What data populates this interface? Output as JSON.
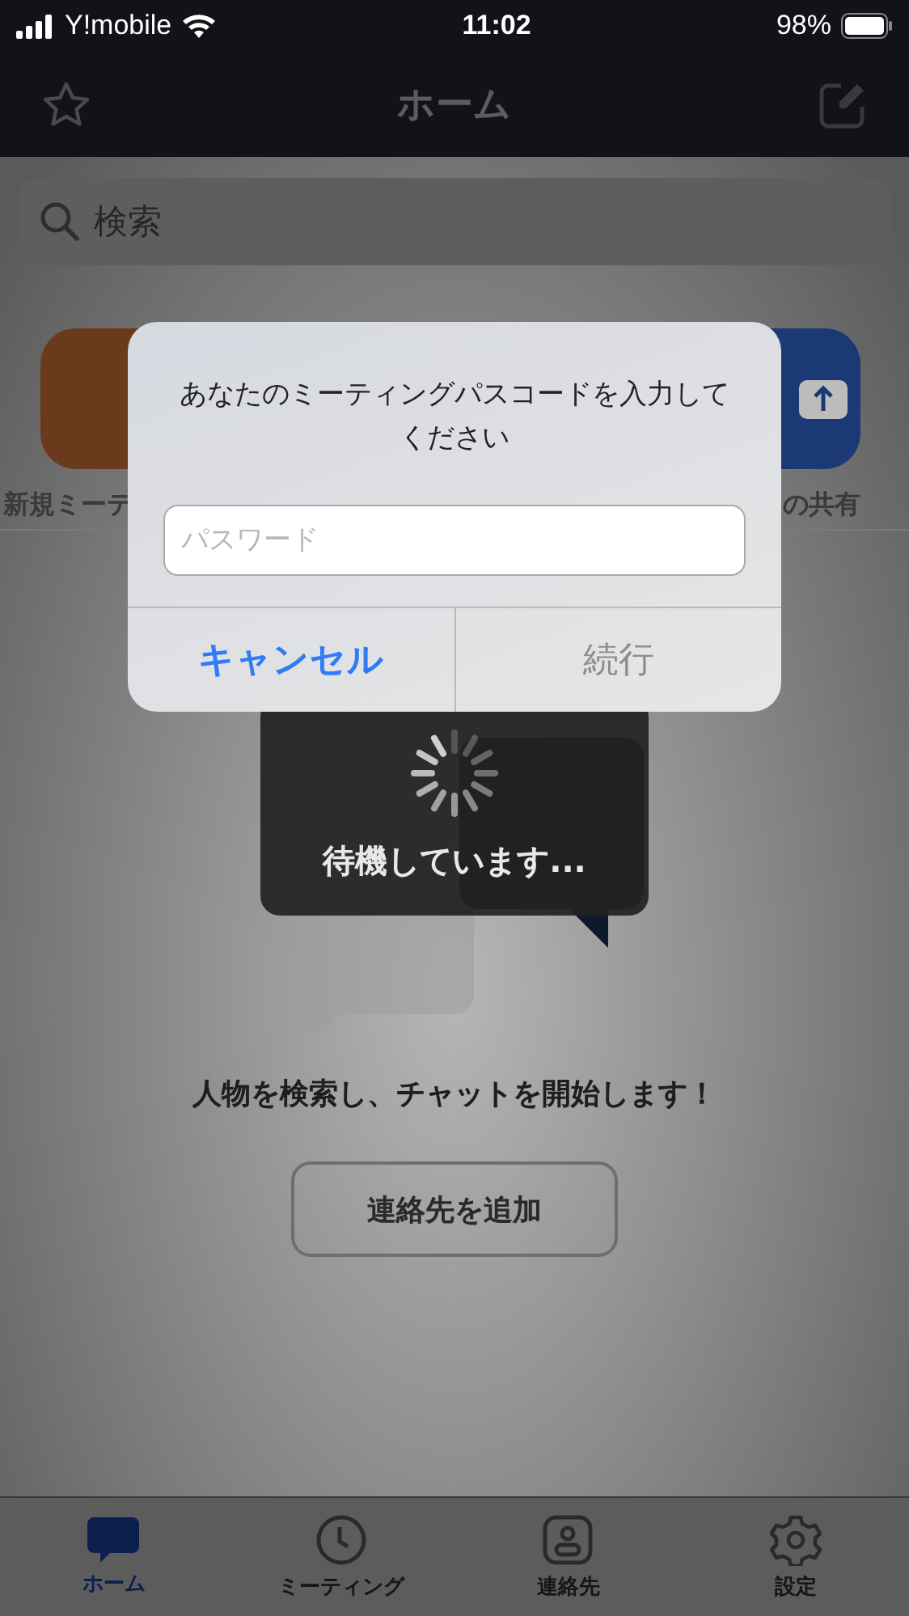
{
  "status_bar": {
    "carrier": "Y!mobile",
    "time": "11:02",
    "battery": "98%"
  },
  "nav": {
    "title": "ホーム"
  },
  "search": {
    "placeholder": "検索"
  },
  "actions": [
    {
      "label": "新規ミーテ",
      "color": "#6b3a1d",
      "kind": "video"
    },
    {
      "label": "の共有",
      "color": "#1b3a75",
      "kind": "share"
    }
  ],
  "hud": {
    "text": "待機しています..."
  },
  "empty": {
    "message": "人物を検索し、チャットを開始します！",
    "button": "連絡先を追加"
  },
  "tabs": [
    {
      "label": "ホーム",
      "selected": true,
      "kind": "chat"
    },
    {
      "label": "ミーティング",
      "selected": false,
      "kind": "clock"
    },
    {
      "label": "連絡先",
      "selected": false,
      "kind": "contact"
    },
    {
      "label": "設定",
      "selected": false,
      "kind": "gear"
    }
  ],
  "dialog": {
    "message": "あなたのミーティングパスコードを入力してください",
    "placeholder": "パスワード",
    "buttons": [
      {
        "label": "キャンセル",
        "disabled": false
      },
      {
        "label": "続行",
        "disabled": true
      }
    ]
  }
}
